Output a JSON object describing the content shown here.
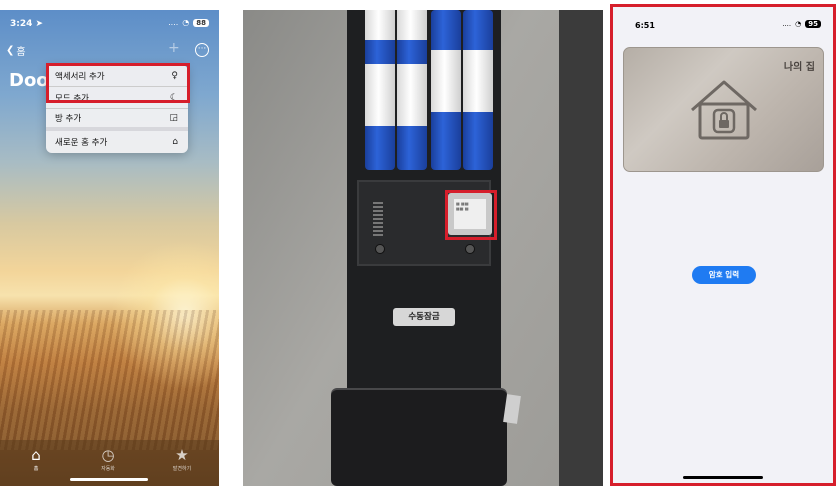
{
  "panel_home": {
    "status": {
      "time": "3:24",
      "battery": "88"
    },
    "back_label": "홈",
    "title": "Doo",
    "menu_items": [
      {
        "label": "액세서리 추가",
        "icon": "lightbulb-icon"
      },
      {
        "label": "모드 추가",
        "icon": "mode-icon"
      },
      {
        "label": "방 추가",
        "icon": "room-icon"
      },
      {
        "label": "새로운 홈 추가",
        "icon": "house-icon"
      }
    ],
    "tabs": [
      {
        "label": "홈",
        "icon": "house-icon"
      },
      {
        "label": "자동화",
        "icon": "clock-icon"
      },
      {
        "label": "발견하기",
        "icon": "star-icon"
      }
    ]
  },
  "panel_lock": {
    "manual_lock_label": "수동잠금"
  },
  "panel_card": {
    "status": {
      "time": "6:51",
      "battery": "95"
    },
    "card_name": "나의 집",
    "password_button": "암호 입력"
  }
}
